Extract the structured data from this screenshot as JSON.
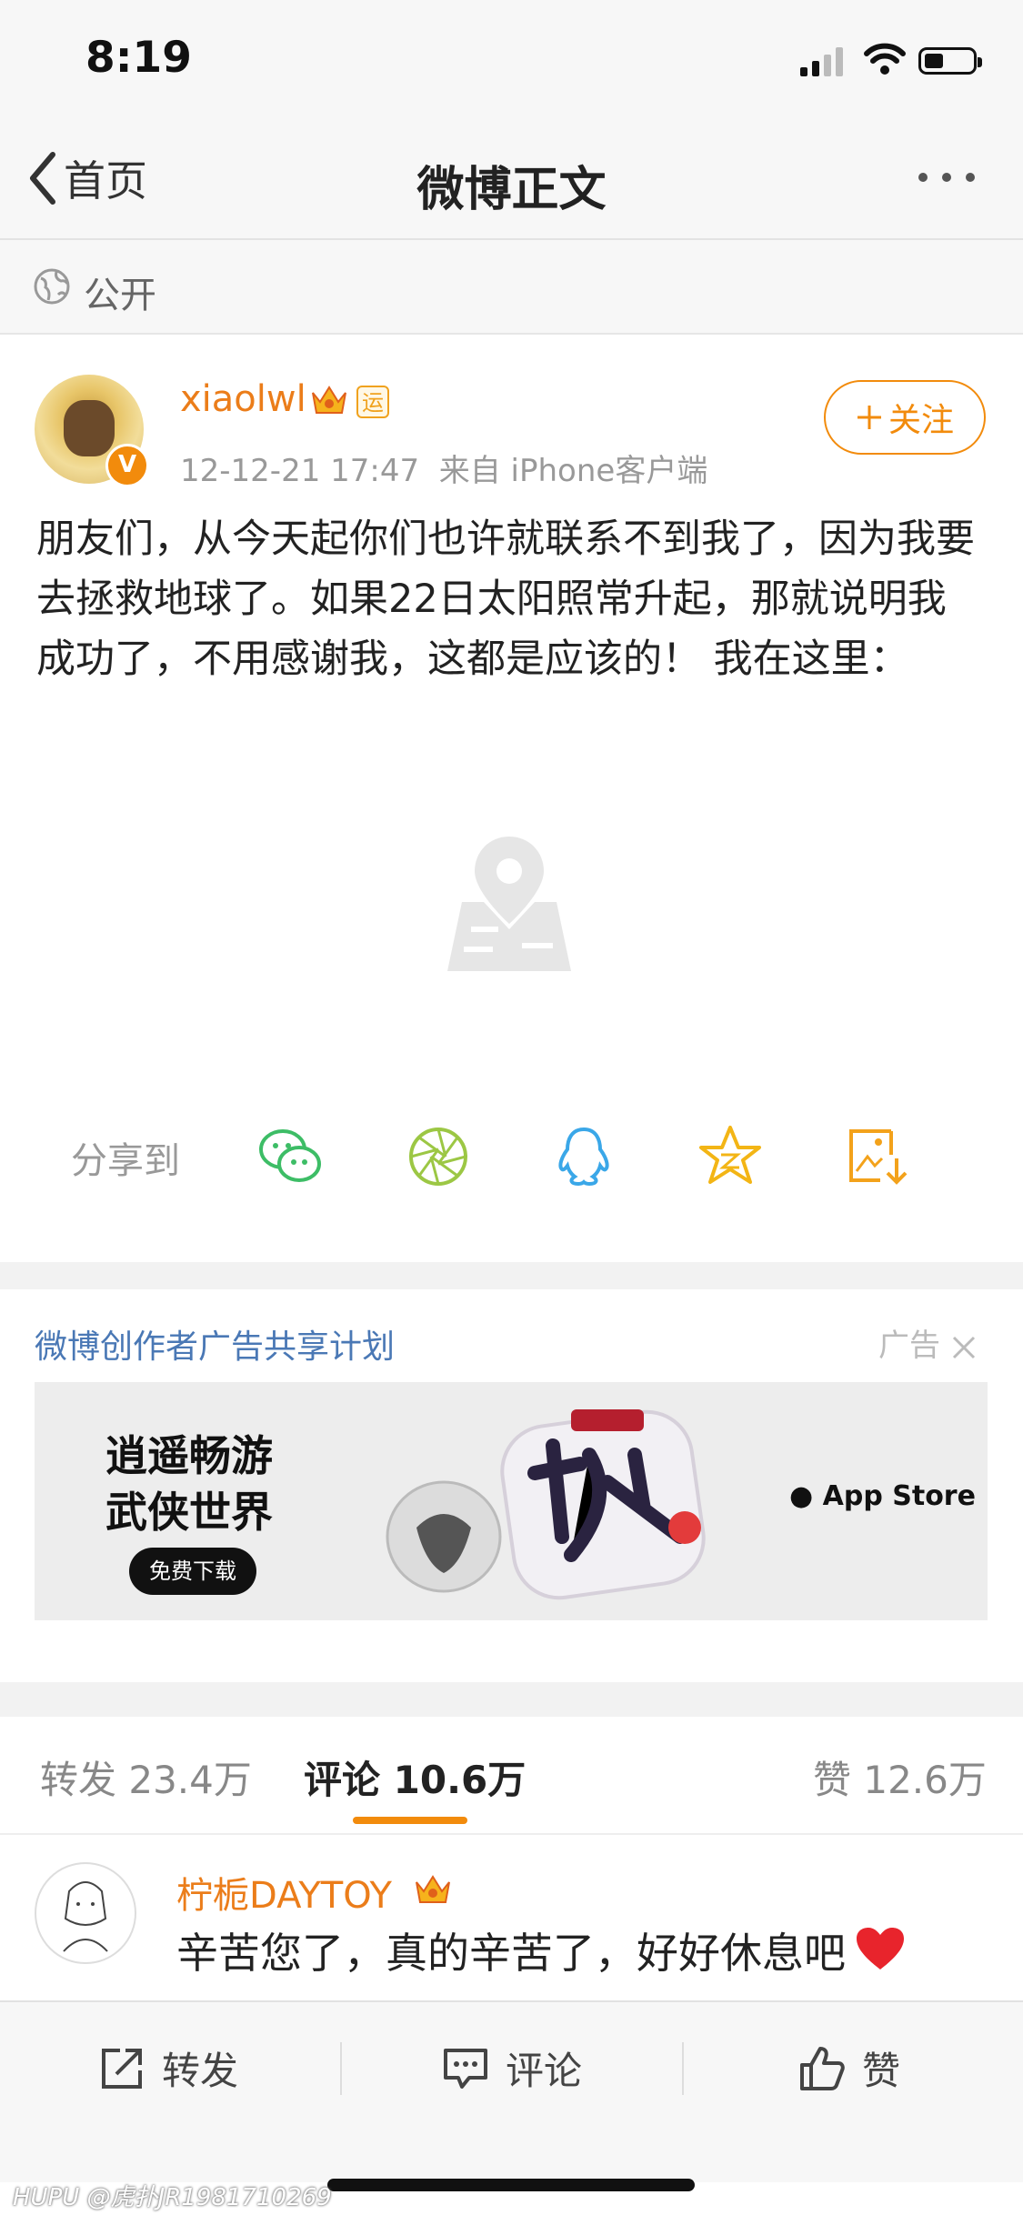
{
  "status_bar": {
    "time": "8:19"
  },
  "nav": {
    "back_label": "首页",
    "title": "微博正文"
  },
  "visibility": {
    "label": "公开"
  },
  "post": {
    "username": "xiaolwl",
    "badge_text": "运",
    "timestamp": "12-12-21 17:47",
    "source": "来自 iPhone客户端",
    "follow_label": "关注",
    "text": "朋友们，从今天起你们也许就联系不到我了，因为我要去拯救地球了。如果22日太阳照常升起，那就说明我成功了，不用感谢我，这都是应该的！ 我在这里："
  },
  "share": {
    "label": "分享到",
    "targets": [
      "wechat-icon",
      "moments-icon",
      "qq-icon",
      "qzone-icon",
      "save-image-icon"
    ]
  },
  "ad": {
    "title": "微博创作者广告共享计划",
    "tag": "广告",
    "headline_line1": "逍遥畅游",
    "headline_line2": "武侠世界",
    "button": "免费下载",
    "store": "App Store"
  },
  "tabs": {
    "repost": "转发 23.4万",
    "comments": "评论 10.6万",
    "likes": "赞 12.6万"
  },
  "comment": {
    "username": "柠栀DAYTOY",
    "text": "辛苦您了，真的辛苦了，好好休息吧"
  },
  "toolbar": {
    "repost": "转发",
    "comment": "评论",
    "like": "赞"
  },
  "watermark": "HUPU @虎扑JR1981710269",
  "colors": {
    "accent": "#f28b0c",
    "username": "#eb7d1a",
    "link": "#4a78b5"
  }
}
